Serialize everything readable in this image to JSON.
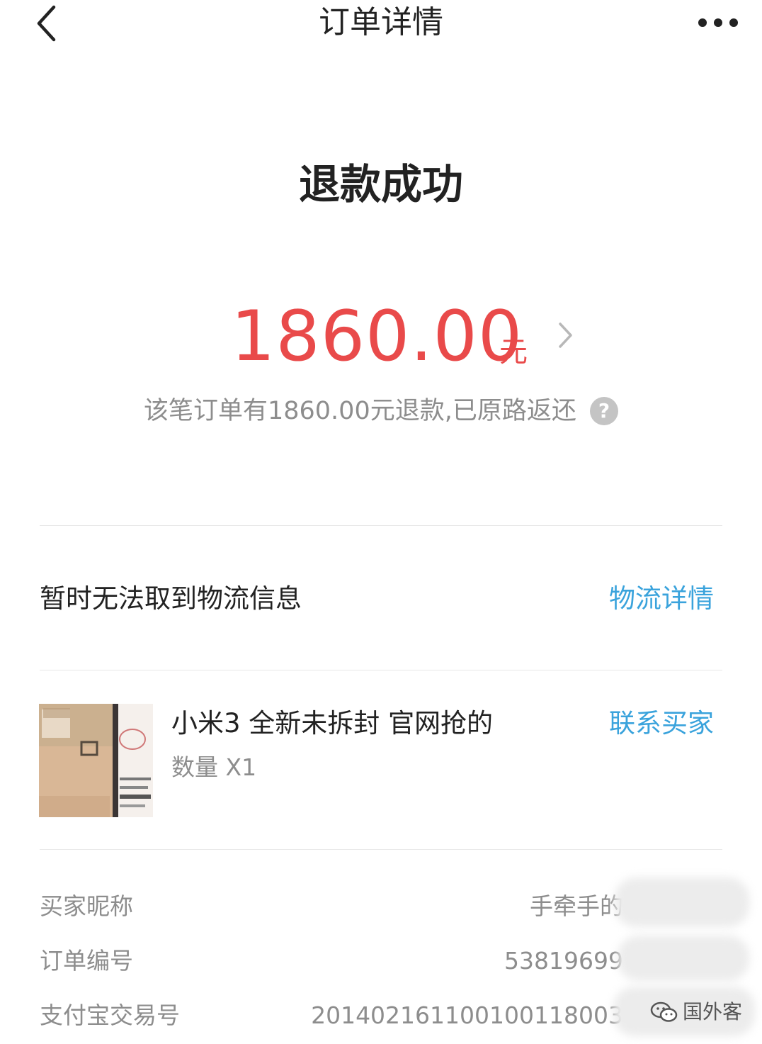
{
  "header": {
    "title": "订单详情",
    "back_icon": "chevron-left-icon",
    "more_icon": "more-horizontal-icon"
  },
  "status": {
    "text": "退款成功"
  },
  "refund": {
    "amount": "1860.00",
    "unit": "元",
    "note": "该笔订单有1860.00元退款,已原路返还",
    "help_icon": "?",
    "amount_color": "#e94a4a"
  },
  "logistics": {
    "message": "暂时无法取到物流信息",
    "link_label": "物流详情",
    "link_color": "#3aa3dc"
  },
  "product": {
    "name": "小米3 全新未拆封 官网抢的",
    "quantity": "数量 X1",
    "contact_label": "联系买家"
  },
  "info": [
    {
      "label": "买家昵称",
      "value": "手牵手的"
    },
    {
      "label": "订单编号",
      "value": "53819699"
    },
    {
      "label": "支付宝交易号",
      "value": "201402161100100118003"
    }
  ],
  "watermark": {
    "text": "国外客"
  }
}
